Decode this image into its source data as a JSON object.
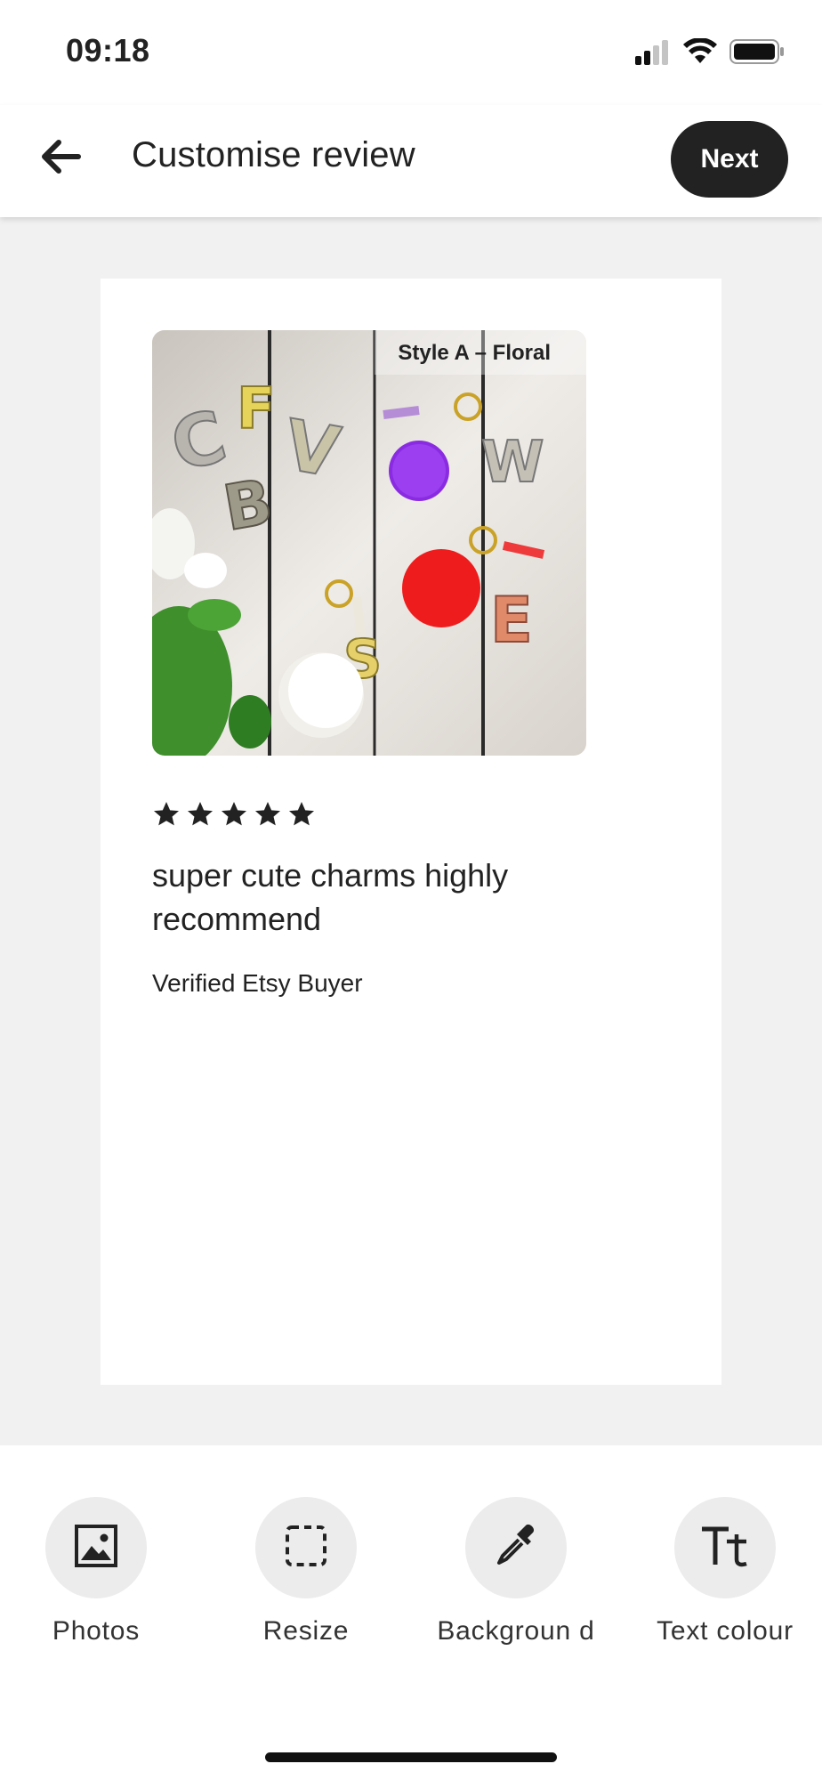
{
  "status_bar": {
    "time": "09:18",
    "icons": [
      "signal-icon",
      "wifi-icon",
      "battery-icon"
    ]
  },
  "header": {
    "title": "Customise review",
    "next_label": "Next"
  },
  "review": {
    "photo_caption": "Style A – Floral",
    "rating": 5,
    "text": "super cute charms highly recommend",
    "reviewer": "Verified Etsy Buyer"
  },
  "toolbar": {
    "items": [
      {
        "label": "Photos",
        "icon": "image-icon"
      },
      {
        "label": "Resize",
        "icon": "resize-icon"
      },
      {
        "label": "Backgroun d",
        "icon": "eyedropper-icon"
      },
      {
        "label": "Text colour",
        "icon": "text-size-icon"
      }
    ]
  },
  "colors": {
    "accent": "#222222",
    "background": "#f1f1f1",
    "card": "#ffffff"
  }
}
